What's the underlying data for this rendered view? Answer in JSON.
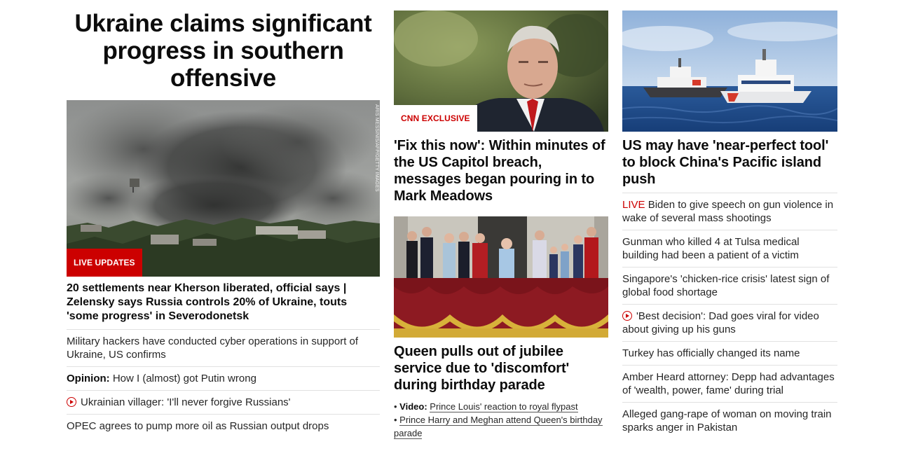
{
  "col1": {
    "headline": "Ukraine claims significant progress in southern offensive",
    "image_badge": "LIVE UPDATES",
    "image_credit": "ARIS MESSINIS/AFP/GETTY IMAGES",
    "lead_title": "20 settlements near Kherson liberated, official says | Zelensky says Russia controls 20% of Ukraine, touts 'some progress' in Severodonetsk",
    "items": [
      {
        "kicker": "",
        "text": "Military hackers have conducted cyber operations in support of Ukraine, US confirms"
      },
      {
        "kicker": "Opinion:",
        "text": "How I (almost) got Putin wrong"
      },
      {
        "kicker": "",
        "video": true,
        "text": "Ukrainian villager: 'I'll never forgive Russians'"
      },
      {
        "kicker": "",
        "text": "OPEC agrees to pump more oil as Russian output drops"
      }
    ]
  },
  "col2": {
    "card1": {
      "badge": "CNN EXCLUSIVE",
      "title": "'Fix this now': Within minutes of the US Capitol breach, messages began pouring in to Mark Meadows"
    },
    "card2": {
      "title": "Queen pulls out of jubilee service due to 'discomfort' during birthday parade",
      "links": [
        {
          "kicker": "Video:",
          "text": "Prince Louis' reaction to royal flypast"
        },
        {
          "kicker": "",
          "text": "Prince Harry and Meghan attend Queen's birthday parade"
        }
      ]
    }
  },
  "col3": {
    "title": "US may have 'near-perfect tool' to block China's Pacific island push",
    "items": [
      {
        "kicker": "LIVE",
        "text": "Biden to give speech on gun violence in wake of several mass shootings"
      },
      {
        "kicker": "",
        "text": "Gunman who killed 4 at Tulsa medical building had been a patient of a victim"
      },
      {
        "kicker": "",
        "text": "Singapore's 'chicken-rice crisis' latest sign of global food shortage"
      },
      {
        "kicker": "",
        "video": true,
        "text": "'Best decision': Dad goes viral for video about giving up his guns"
      },
      {
        "kicker": "",
        "text": "Turkey has officially changed its name"
      },
      {
        "kicker": "",
        "text": "Amber Heard attorney: Depp had advantages of 'wealth, power, fame' during trial"
      },
      {
        "kicker": "",
        "text": "Alleged gang-rape of woman on moving train sparks anger in Pakistan"
      }
    ]
  },
  "colors": {
    "accent_red": "#cc0000",
    "text": "#0c0c0c",
    "divider": "#e1e1e1"
  }
}
